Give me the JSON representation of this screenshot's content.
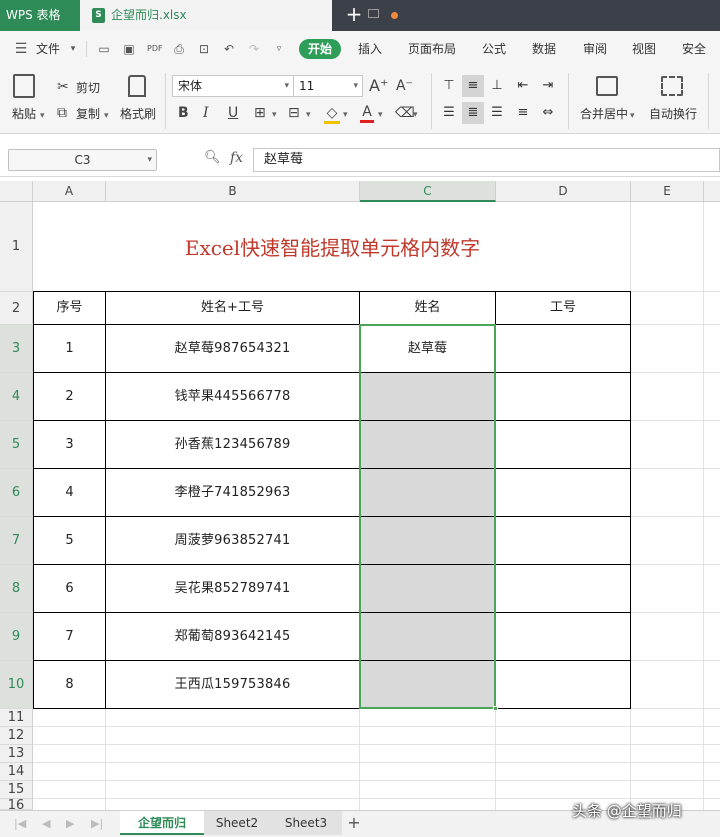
{
  "titlebar": {
    "app_name": "WPS 表格",
    "file_name": "企望而归.xlsx",
    "new_tab": "+"
  },
  "menubar": {
    "file_menu": "文件",
    "tabs": [
      "开始",
      "插入",
      "页面布局",
      "公式",
      "数据",
      "审阅",
      "视图",
      "安全"
    ],
    "active_tab": "开始"
  },
  "ribbon": {
    "paste": "粘贴",
    "cut": "剪切",
    "copy": "复制",
    "format_painter": "格式刷",
    "font_name": "宋体",
    "font_size": "11",
    "merge_center": "合并居中",
    "auto_wrap": "自动换行"
  },
  "formula_bar": {
    "cell_ref": "C3",
    "fx": "fx",
    "value": "赵草莓"
  },
  "columns": [
    "A",
    "B",
    "C",
    "D",
    "E"
  ],
  "rows": [
    "1",
    "2",
    "3",
    "4",
    "5",
    "6",
    "7",
    "8",
    "9",
    "10",
    "11",
    "12",
    "13",
    "14",
    "15",
    "16"
  ],
  "sheet": {
    "title": "Excel快速智能提取单元格内数字",
    "headers": [
      "序号",
      "姓名+工号",
      "姓名",
      "工号"
    ],
    "records": [
      {
        "no": "1",
        "name_id": "赵草莓987654321",
        "name": "赵草莓",
        "id": ""
      },
      {
        "no": "2",
        "name_id": "钱苹果445566778",
        "name": "",
        "id": ""
      },
      {
        "no": "3",
        "name_id": "孙香蕉123456789",
        "name": "",
        "id": ""
      },
      {
        "no": "4",
        "name_id": "李橙子741852963",
        "name": "",
        "id": ""
      },
      {
        "no": "5",
        "name_id": "周菠萝963852741",
        "name": "",
        "id": ""
      },
      {
        "no": "6",
        "name_id": "吴花果852789741",
        "name": "",
        "id": ""
      },
      {
        "no": "7",
        "name_id": "郑葡萄893642145",
        "name": "",
        "id": ""
      },
      {
        "no": "8",
        "name_id": "王西瓜159753846",
        "name": "",
        "id": ""
      }
    ]
  },
  "sheet_tabs": [
    "企望而归",
    "Sheet2",
    "Sheet3"
  ],
  "active_sheet": "企望而归",
  "watermark": "头条 @企望而归",
  "colors": {
    "accent": "#2e8b57",
    "title_red": "#c0392b",
    "selection_border": "#4aa55a",
    "fill_gray": "#d9d9d9"
  }
}
